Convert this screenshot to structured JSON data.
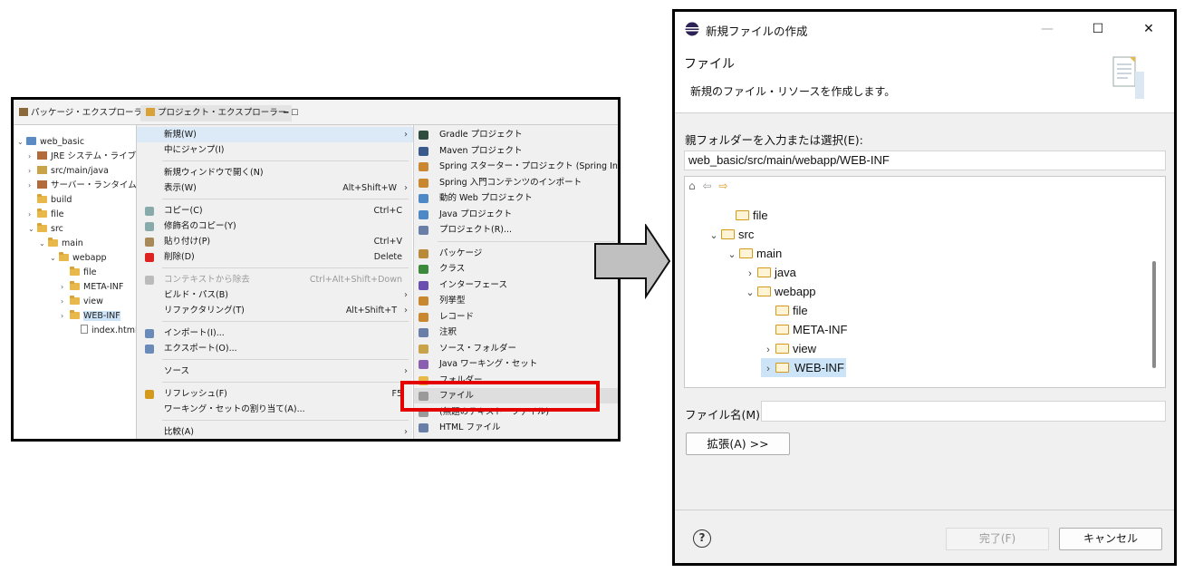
{
  "left_panel": {
    "tabs": [
      {
        "label": "パッケージ・エクスプローラー ✕"
      },
      {
        "label": "プロジェクト・エクスプローラー"
      }
    ],
    "tree": [
      {
        "label": "web_basic",
        "arrow": "⌄",
        "icon": "project"
      },
      {
        "label": "JRE システム・ライブラリ",
        "arrow": "›",
        "icon": "library"
      },
      {
        "label": "src/main/java",
        "arrow": "›",
        "icon": "package"
      },
      {
        "label": "サーバー・ランタイム [To",
        "arrow": "›",
        "icon": "library"
      },
      {
        "label": "build",
        "arrow": "",
        "icon": "folder"
      },
      {
        "label": "file",
        "arrow": "›",
        "icon": "folder"
      },
      {
        "label": "src",
        "arrow": "⌄",
        "icon": "folder"
      },
      {
        "label": "main",
        "arrow": "⌄",
        "icon": "folder"
      },
      {
        "label": "webapp",
        "arrow": "⌄",
        "icon": "folder"
      },
      {
        "label": "file",
        "arrow": "",
        "icon": "folder"
      },
      {
        "label": "META-INF",
        "arrow": "›",
        "icon": "folder"
      },
      {
        "label": "view",
        "arrow": "›",
        "icon": "folder"
      },
      {
        "label": "WEB-INF",
        "arrow": "›",
        "icon": "folder",
        "selected": true
      },
      {
        "label": "index.html",
        "arrow": "",
        "icon": "file"
      }
    ],
    "context_menu": [
      {
        "label": "新規(W)",
        "shortcut": "",
        "submenu": true,
        "highlight": true,
        "icon": ""
      },
      {
        "label": "中にジャンプ(I)",
        "shortcut": "",
        "icon": ""
      },
      {
        "sep": true
      },
      {
        "label": "新規ウィンドウで開く(N)",
        "shortcut": "",
        "icon": ""
      },
      {
        "label": "表示(W)",
        "shortcut": "Alt+Shift+W",
        "submenu": true,
        "icon": ""
      },
      {
        "sep": true
      },
      {
        "label": "コピー(C)",
        "shortcut": "Ctrl+C",
        "icon": "copy-icon"
      },
      {
        "label": "修飾名のコピー(Y)",
        "shortcut": "",
        "icon": "copy-qualified-icon"
      },
      {
        "label": "貼り付け(P)",
        "shortcut": "Ctrl+V",
        "icon": "paste-icon"
      },
      {
        "label": "削除(D)",
        "shortcut": "Delete",
        "icon": "delete-icon"
      },
      {
        "sep": true
      },
      {
        "label": "コンテキストから除去",
        "shortcut": "Ctrl+Alt+Shift+Down",
        "disabled": true,
        "icon": "remove-context-icon"
      },
      {
        "label": "ビルド・パス(B)",
        "shortcut": "",
        "submenu": true,
        "icon": ""
      },
      {
        "label": "リファクタリング(T)",
        "shortcut": "Alt+Shift+T",
        "submenu": true,
        "icon": ""
      },
      {
        "sep": true
      },
      {
        "label": "インポート(I)...",
        "shortcut": "",
        "icon": "import-icon"
      },
      {
        "label": "エクスポート(O)...",
        "shortcut": "",
        "icon": "export-icon"
      },
      {
        "sep": true
      },
      {
        "label": "ソース",
        "shortcut": "",
        "submenu": true,
        "icon": ""
      },
      {
        "sep": true
      },
      {
        "label": "リフレッシュ(F)",
        "shortcut": "F5",
        "icon": "refresh-icon"
      },
      {
        "label": "ワーキング・セットの割り当て(A)...",
        "shortcut": "",
        "icon": ""
      },
      {
        "sep": true
      },
      {
        "label": "比較(A)",
        "shortcut": "",
        "submenu": true,
        "icon": ""
      }
    ],
    "submenu": [
      {
        "label": "Gradle プロジェクト",
        "color": "#2f4d3e"
      },
      {
        "label": "Maven プロジェクト",
        "color": "#3b5a8c"
      },
      {
        "label": "Spring スターター・プロジェクト (Spring Initializr)",
        "color": "#c9882f"
      },
      {
        "label": "Spring 入門コンテンツのインポート",
        "color": "#c9882f"
      },
      {
        "label": "動的 Web プロジェクト",
        "color": "#4f88c6"
      },
      {
        "label": "Java プロジェクト",
        "color": "#4f88c6"
      },
      {
        "label": "プロジェクト(R)...",
        "color": "#6a7fa8"
      },
      {
        "sep": true
      },
      {
        "label": "パッケージ",
        "color": "#b98a3a"
      },
      {
        "label": "クラス",
        "color": "#3b8a3b"
      },
      {
        "label": "インターフェース",
        "color": "#6b4fb0"
      },
      {
        "label": "列挙型",
        "color": "#c9882f"
      },
      {
        "label": "レコード",
        "color": "#c9882f"
      },
      {
        "label": "注釈",
        "color": "#6a7fa8"
      },
      {
        "label": "ソース・フォルダー",
        "color": "#c9a34a"
      },
      {
        "label": "Java ワーキング・セット",
        "color": "#8a5fb0"
      },
      {
        "label": "フォルダー",
        "color": "#e8b84a"
      },
      {
        "label": "ファイル",
        "color": "#9a9a9a",
        "highlight": true
      },
      {
        "label": "(無題のテキスト・ファイル)",
        "color": "#9a9a9a"
      },
      {
        "label": "HTML ファイル",
        "color": "#6a7fa8"
      }
    ]
  },
  "dialog": {
    "title": "新規ファイルの作成",
    "window_buttons": {
      "minimize": "—",
      "maximize": "☐",
      "close": "✕"
    },
    "header_title": "ファイル",
    "header_desc": "新規のファイル・リソースを作成します。",
    "parent_label": "親フォルダーを入力または選択(E):",
    "parent_value": "web_basic/src/main/webapp/WEB-INF",
    "tree_toolbar": "⌂ ⇦ ⇨",
    "tree": [
      {
        "label": "file",
        "arrow": ""
      },
      {
        "label": "src",
        "arrow": "⌄"
      },
      {
        "label": "main",
        "arrow": "⌄"
      },
      {
        "label": "java",
        "arrow": "›"
      },
      {
        "label": "webapp",
        "arrow": "⌄"
      },
      {
        "label": "file",
        "arrow": ""
      },
      {
        "label": "META-INF",
        "arrow": ""
      },
      {
        "label": "view",
        "arrow": "›"
      },
      {
        "label": "WEB-INF",
        "arrow": "›",
        "selected": true
      }
    ],
    "filename_label": "ファイル名(M):",
    "filename_value": "",
    "advanced_button": "拡張(A) >>",
    "help": "?",
    "finish_button": "完了(F)",
    "cancel_button": "キャンセル"
  }
}
